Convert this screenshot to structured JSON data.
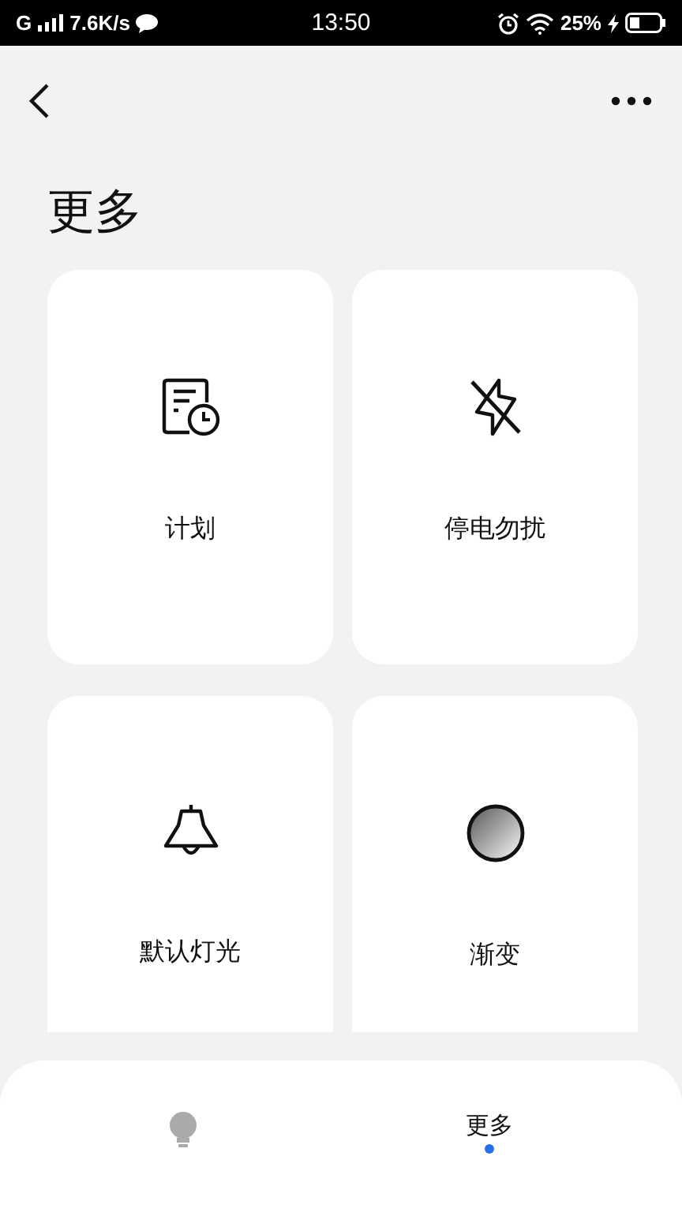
{
  "status_bar": {
    "network": "G",
    "speed": "7.6K/s",
    "time": "13:50",
    "battery": "25%"
  },
  "title": "更多",
  "cards": [
    {
      "kind": "schedule",
      "label": "计划"
    },
    {
      "kind": "no-flash",
      "label": "停电勿扰"
    },
    {
      "kind": "bell",
      "label": "默认灯光"
    },
    {
      "kind": "gradient",
      "label": "渐变"
    }
  ],
  "bottom_nav": [
    {
      "kind": "bulb",
      "selected": false
    },
    {
      "kind": "text",
      "label": "更多",
      "selected": true
    }
  ]
}
